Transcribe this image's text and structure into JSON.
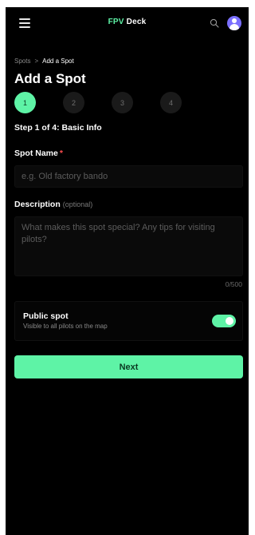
{
  "header": {
    "brand_part1": "FPV",
    "brand_part2": "Deck",
    "menu_icon": "hamburger-menu-icon",
    "search_icon": "search-icon",
    "avatar_icon": "user-avatar"
  },
  "breadcrumb": {
    "parent": "Spots",
    "separator": ">",
    "current": "Add a Spot"
  },
  "page": {
    "title": "Add a Spot"
  },
  "stepper": {
    "steps": [
      "1",
      "2",
      "3",
      "4"
    ],
    "active_step": 1,
    "label": "Step 1 of 4: Basic Info"
  },
  "form": {
    "spot_name": {
      "label": "Spot Name",
      "required_marker": "*",
      "value": "",
      "placeholder": "e.g. Old factory bando"
    },
    "description": {
      "label": "Description",
      "optional_note": "(optional)",
      "value": "",
      "placeholder": "What makes this spot special? Any tips for visiting pilots?",
      "char_count": "0/500"
    },
    "public_spot": {
      "title": "Public spot",
      "subtitle": "Visible to all pilots on the map",
      "enabled": true
    },
    "next_label": "Next"
  },
  "colors": {
    "accent": "#5ef3a6",
    "background": "#000000",
    "required": "#ff4d4f",
    "avatar": "#7b70ff"
  }
}
